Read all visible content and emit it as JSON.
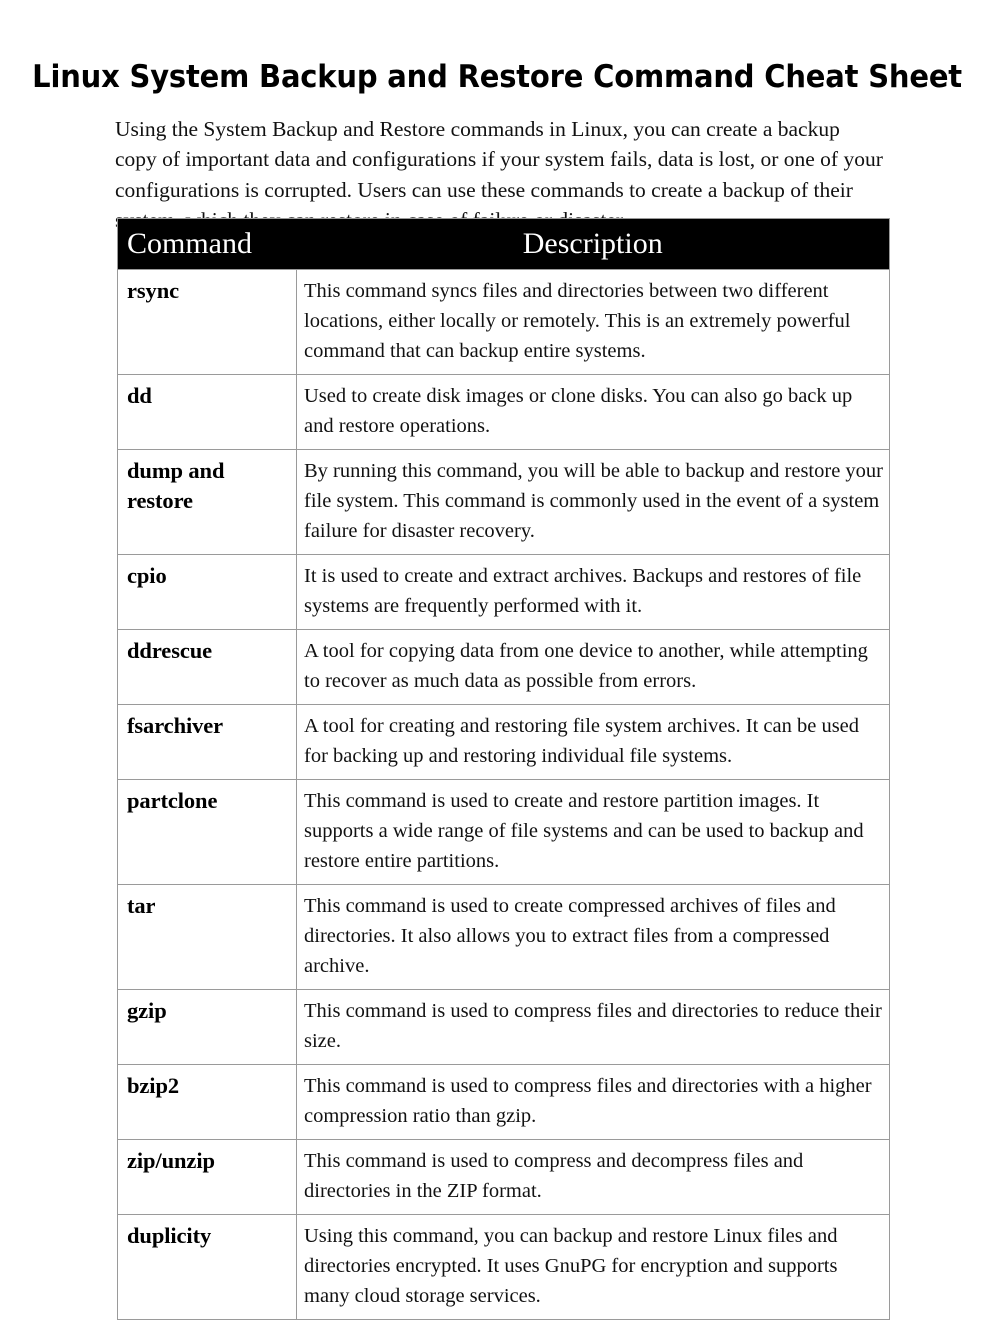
{
  "document": {
    "title": "Linux System Backup and Restore Command Cheat Sheet",
    "intro": "Using the System Backup and Restore commands in Linux, you can create a backup copy of important data and configurations if your system fails, data is lost, or one of your configurations is corrupted. Users can use these commands to create a backup of their system, which they can restore in case of failure or disaster."
  },
  "table": {
    "headers": {
      "command": "Command",
      "description": "Description"
    },
    "header_background": "#000000",
    "header_text_color": "#ffffff",
    "border_color": "#9a9a9a",
    "rows": [
      {
        "command": "rsync",
        "description": "This command syncs files and directories between two different locations, either locally or remotely. This is an extremely powerful command that can backup entire systems."
      },
      {
        "command": "dd",
        "description": "Used to create disk images or clone disks. You can also go back up and restore operations."
      },
      {
        "command": "dump and restore",
        "description": "By running this command, you will be able to backup and restore your file system. This command is commonly used in the event of a system failure for disaster recovery."
      },
      {
        "command": "cpio",
        "description": "It is used to create and extract archives. Backups and restores of file systems are frequently performed with it."
      },
      {
        "command": "ddrescue",
        "description": "A tool for copying data from one device to another, while attempting to recover as much data as possible from errors."
      },
      {
        "command": "fsarchiver",
        "description": "A tool for creating and restoring file system archives. It can be used for backing up and restoring individual file systems."
      },
      {
        "command": "partclone",
        "description": "This command is used to create and restore partition images. It supports a wide range of file systems and can be used to backup and restore entire partitions."
      },
      {
        "command": "tar",
        "description": "This command is used to create compressed archives of files and directories. It also allows you to extract files from a compressed archive."
      },
      {
        "command": "gzip",
        "description": "This command is used to compress files and directories to reduce their size."
      },
      {
        "command": "bzip2",
        "description": "This command is used to compress files and directories with a higher compression ratio than gzip."
      },
      {
        "command": "zip/unzip",
        "description": "This command is used to compress and decompress files and directories in the ZIP format."
      },
      {
        "command": "duplicity",
        "description": "Using this command, you can backup and restore Linux files and directories encrypted. It uses GnuPG for encryption and supports many cloud storage services."
      }
    ]
  }
}
